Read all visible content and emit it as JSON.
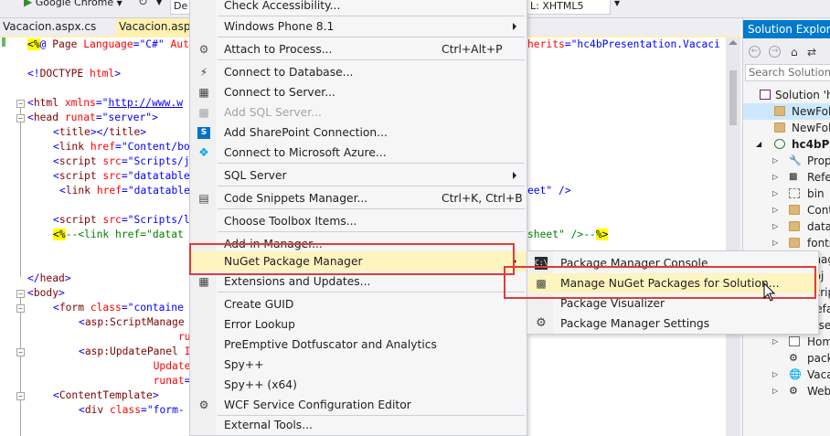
{
  "toolbar": {
    "browser_label": "Google Chrome",
    "config_combo": "De",
    "schema_combo": "L: XHTML5"
  },
  "tabs": [
    {
      "label": "Vacacion.aspx.cs",
      "close": "✕"
    },
    {
      "label": "Vacacion.aspx",
      "close": "✕"
    }
  ],
  "code_lines": [
    {
      "text": "<%@ Page Language=\"C#\" Aut"
    },
    {
      "text": "<!DOCTYPE html>"
    },
    {
      "text": "<html xmlns=\"http://www.w"
    },
    {
      "text": "<head runat=\"server\">"
    },
    {
      "text": "    <title></title>"
    },
    {
      "text": "    <link href=\"Content/bo"
    },
    {
      "text": "    <script src=\"Scripts/j"
    },
    {
      "text": "    <script src=\"datatable"
    },
    {
      "text": "     <link href=\"datatable"
    },
    {
      "text": "    <script src=\"Scripts/l"
    },
    {
      "text": "    <%--<link href=\"datat"
    },
    {
      "text": "</head>"
    },
    {
      "text": "<body>"
    },
    {
      "text": "    <form class=\"containe"
    },
    {
      "text": "        <asp:ScriptManage"
    },
    {
      "text": "                    runat="
    },
    {
      "text": "        <asp:UpdatePanel I"
    },
    {
      "text": "                    UpdateMo"
    },
    {
      "text": "                    runat=\"s"
    },
    {
      "text": "    <ContentTemplate>"
    },
    {
      "text": "        <div class=\"form-"
    }
  ],
  "code_right": {
    "inherits": "herits=\"hc4bPresentation.Vacaci",
    "sheet1": "eet\" />",
    "sheet2": "sheet\" />--%>"
  },
  "menu": {
    "items": [
      {
        "label": "Check Accessibility...",
        "shortcut": "",
        "disabled": false
      },
      {
        "label": "Windows Phone 8.1",
        "shortcut": "",
        "submenu": true
      },
      {
        "label": "Attach to Process...",
        "shortcut": "Ctrl+Alt+P",
        "icon": "attach-icon"
      },
      {
        "label": "Connect to Database...",
        "shortcut": "",
        "icon": "database-connect-icon"
      },
      {
        "label": "Connect to Server...",
        "shortcut": "",
        "icon": "server-connect-icon"
      },
      {
        "label": "Add SQL Server...",
        "shortcut": "",
        "disabled": true,
        "icon": "sql-server-icon"
      },
      {
        "label": "Add SharePoint Connection...",
        "shortcut": "",
        "icon": "sharepoint-icon"
      },
      {
        "label": "Connect to Microsoft Azure...",
        "shortcut": "",
        "icon": "azure-icon"
      },
      {
        "label": "SQL Server",
        "shortcut": "",
        "submenu": true
      },
      {
        "label": "Code Snippets Manager...",
        "shortcut": "Ctrl+K, Ctrl+B",
        "icon": "snippets-icon"
      },
      {
        "label": "Choose Toolbox Items...",
        "shortcut": ""
      },
      {
        "label": "Add-in Manager...",
        "shortcut": ""
      },
      {
        "label": "NuGet Package Manager",
        "shortcut": "",
        "submenu": true,
        "hover": true
      },
      {
        "label": "Extensions and Updates...",
        "shortcut": "",
        "icon": "extensions-icon"
      },
      {
        "label": "Create GUID",
        "shortcut": ""
      },
      {
        "label": "Error Lookup",
        "shortcut": ""
      },
      {
        "label": "PreEmptive Dotfuscator and Analytics",
        "shortcut": ""
      },
      {
        "label": "Spy++",
        "shortcut": ""
      },
      {
        "label": "Spy++ (x64)",
        "shortcut": ""
      },
      {
        "label": "WCF Service Configuration Editor",
        "shortcut": ""
      },
      {
        "label": "External Tools...",
        "shortcut": ""
      }
    ]
  },
  "submenu": {
    "items": [
      {
        "label": "Package Manager Console",
        "icon": "console-icon"
      },
      {
        "label": "Manage NuGet Packages for Solution...",
        "icon": "nuget-package-icon",
        "hover": true
      },
      {
        "label": "Package Visualizer",
        "icon": "visualizer-icon"
      },
      {
        "label": "Package Manager Settings",
        "icon": "gear-icon"
      }
    ]
  },
  "solution_explorer": {
    "title": "Solution Explorer",
    "search_placeholder": "Search Solution E",
    "items": [
      {
        "label": "Solution 'hc"
      },
      {
        "label": "NewFol"
      },
      {
        "label": "NewFol"
      },
      {
        "label": "hc4bPre"
      },
      {
        "label": "Prop"
      },
      {
        "label": "Refe"
      },
      {
        "label": "bin"
      },
      {
        "label": "Cont"
      },
      {
        "label": "data"
      },
      {
        "label": "fonts"
      },
      {
        "label": "imag"
      },
      {
        "label": "obj"
      },
      {
        "label": "Scrip"
      },
      {
        "label": "Defa"
      },
      {
        "label": "Diser"
      },
      {
        "label": "Hom"
      },
      {
        "label": "pack"
      },
      {
        "label": "Vaca"
      },
      {
        "label": "Web"
      }
    ]
  },
  "colors": {
    "accent": "#007acc",
    "highlight_box": "#e23a3a",
    "menu_hover": "#fdf4bf",
    "active_tab": "#fff1b0"
  }
}
